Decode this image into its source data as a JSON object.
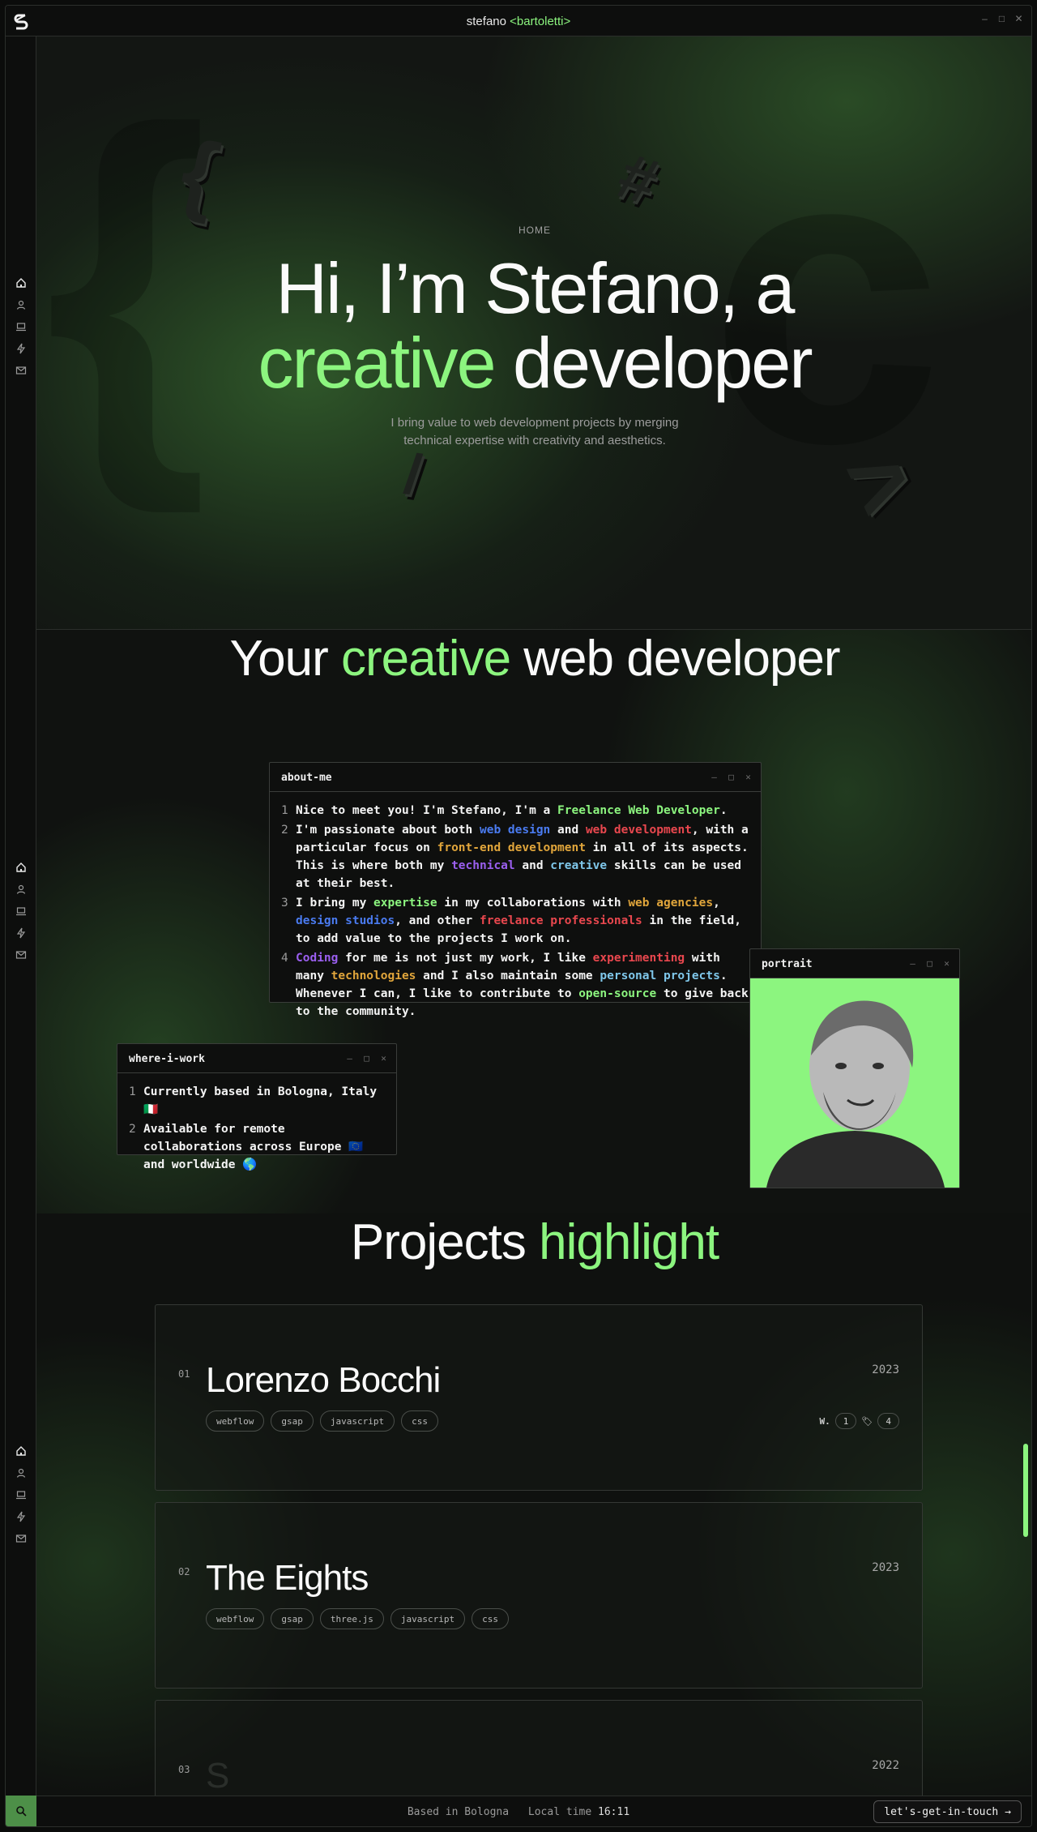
{
  "site": {
    "title_name": "stefano",
    "title_accent": "<bartoletti>"
  },
  "hero": {
    "eyebrow": "HOME",
    "title_line1": "Hi, I’m Stefano, a",
    "title_accent": "creative",
    "title_rest": "developer",
    "subtitle_line1": "I bring value to web development projects by merging",
    "subtitle_line2": "technical expertise with creativity and aesthetics.",
    "deco_glyphs": [
      "{",
      "#",
      "/",
      ">"
    ]
  },
  "about": {
    "title_pre": "Your",
    "title_accent": "creative",
    "title_post": "web developer",
    "about_window": {
      "title": "about-me",
      "lines": [
        {
          "n": "1",
          "parts": [
            [
              "Nice to meet you! I'm Stefano, I'm a ",
              ""
            ],
            [
              "Freelance Web Developer",
              "green"
            ],
            [
              ".",
              ""
            ]
          ]
        },
        {
          "n": "2",
          "parts": [
            [
              "I'm passionate about both ",
              ""
            ],
            [
              "web design",
              "blue"
            ],
            [
              " and ",
              ""
            ],
            [
              "web development",
              "red"
            ],
            [
              ", with a particular focus on ",
              ""
            ],
            [
              "front-end development",
              "orange"
            ],
            [
              " in all of its aspects. This is where both my ",
              ""
            ],
            [
              "technical",
              "purple"
            ],
            [
              " and ",
              ""
            ],
            [
              "creative",
              "cyan"
            ],
            [
              " skills can be used at their best.",
              ""
            ]
          ]
        },
        {
          "n": "3",
          "parts": [
            [
              "I bring my ",
              ""
            ],
            [
              "expertise",
              "green"
            ],
            [
              " in my collaborations with ",
              ""
            ],
            [
              "web agencies",
              "orange"
            ],
            [
              ", ",
              ""
            ],
            [
              "design studios",
              "blue"
            ],
            [
              ", and other ",
              ""
            ],
            [
              "freelance professionals",
              "red"
            ],
            [
              " in the field, to add value to the projects I work on.",
              ""
            ]
          ]
        },
        {
          "n": "4",
          "parts": [
            [
              "Coding",
              "purple"
            ],
            [
              " for me is not just my work, I like ",
              ""
            ],
            [
              "experimenting",
              "red"
            ],
            [
              " with many ",
              ""
            ],
            [
              "technologies",
              "orange"
            ],
            [
              " and I also maintain some ",
              ""
            ],
            [
              "personal projects",
              "cyan"
            ],
            [
              ". Whenever I can, I like to contribute to ",
              ""
            ],
            [
              "open-source",
              "green"
            ],
            [
              " to give back to the community.",
              ""
            ]
          ]
        }
      ]
    },
    "work_window": {
      "title": "where-i-work",
      "lines": [
        {
          "n": "1",
          "text": "Currently based in Bologna, Italy 🇮🇹"
        },
        {
          "n": "2",
          "text": "Available for remote collaborations across Europe 🇪🇺 and worldwide 🌎"
        }
      ]
    },
    "portrait_window": {
      "title": "portrait"
    }
  },
  "projects": {
    "title_pre": "Projects",
    "title_accent": "highlight",
    "items": [
      {
        "num": "01",
        "name": "Lorenzo Bocchi",
        "year": "2023",
        "tags": [
          "webflow",
          "gsap",
          "javascript",
          "css"
        ],
        "awards_label": "W.",
        "award_w": "1",
        "award_tag": "4"
      },
      {
        "num": "02",
        "name": "The Eights",
        "year": "2023",
        "tags": [
          "webflow",
          "gsap",
          "three.js",
          "javascript",
          "css"
        ]
      },
      {
        "num": "03",
        "name": "S",
        "year": "2022",
        "tags": []
      }
    ]
  },
  "footer": {
    "based": "Based in Bologna",
    "local_time_label": "Local time",
    "local_time": "16:11",
    "cta": "let's-get-in-touch"
  },
  "colors": {
    "accent": "#8cf57f",
    "blue": "#4a7bf0",
    "red": "#e8474e",
    "orange": "#e0a53b",
    "purple": "#9b5ff0",
    "cyan": "#7fc7ea"
  },
  "icons": [
    "logo-icon",
    "home-icon",
    "user-icon",
    "laptop-icon",
    "bolt-icon",
    "mail-icon",
    "search-icon",
    "arrow-right-icon"
  ]
}
